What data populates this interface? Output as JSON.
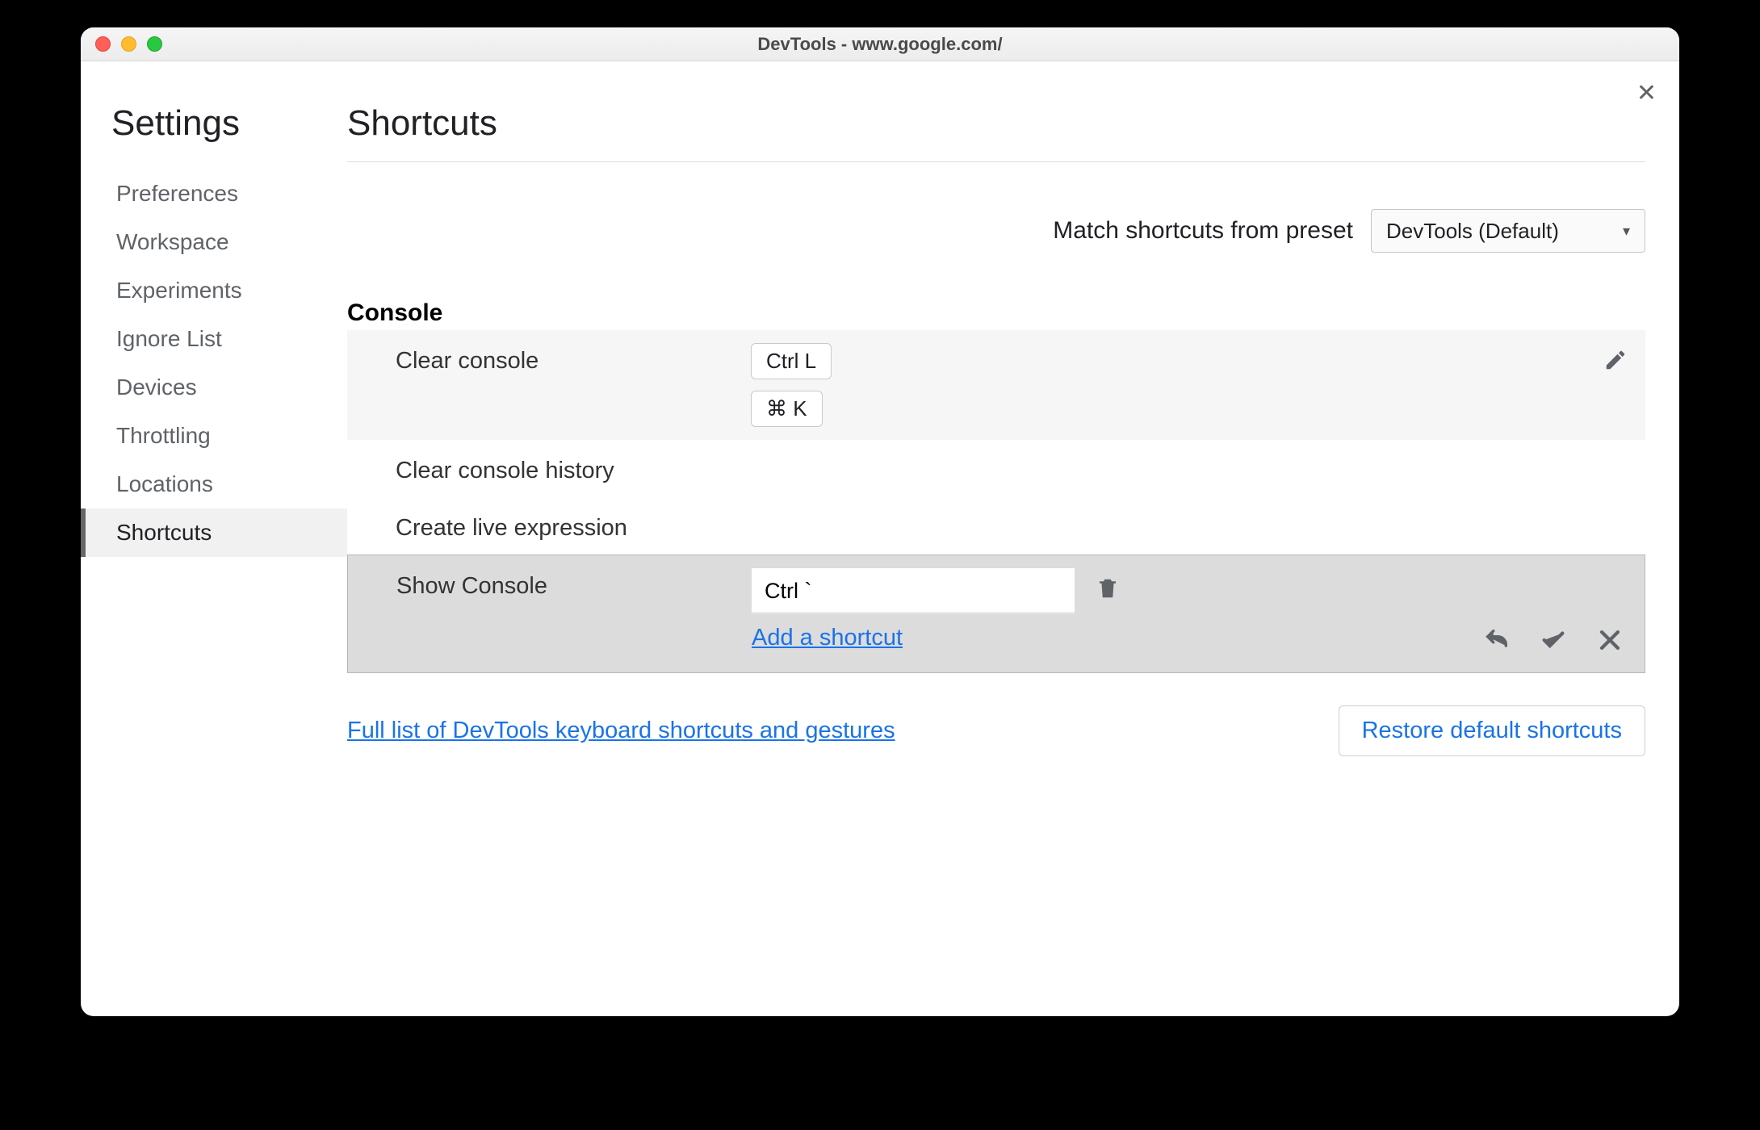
{
  "window": {
    "title": "DevTools - www.google.com/"
  },
  "sidebar": {
    "heading": "Settings",
    "items": [
      {
        "label": "Preferences"
      },
      {
        "label": "Workspace"
      },
      {
        "label": "Experiments"
      },
      {
        "label": "Ignore List"
      },
      {
        "label": "Devices"
      },
      {
        "label": "Throttling"
      },
      {
        "label": "Locations"
      },
      {
        "label": "Shortcuts"
      }
    ],
    "active_index": 7
  },
  "main": {
    "heading": "Shortcuts",
    "preset_label": "Match shortcuts from preset",
    "preset_value": "DevTools (Default)",
    "section": "Console",
    "rows": {
      "clear_console": {
        "label": "Clear console",
        "key1": "Ctrl L",
        "key2": "⌘ K"
      },
      "clear_history": {
        "label": "Clear console history"
      },
      "create_live": {
        "label": "Create live expression"
      },
      "show_console": {
        "label": "Show Console",
        "input_value": "Ctrl `",
        "add_link": "Add a shortcut"
      }
    },
    "footer": {
      "doc_link": "Full list of DevTools keyboard shortcuts and gestures",
      "restore": "Restore default shortcuts"
    }
  }
}
